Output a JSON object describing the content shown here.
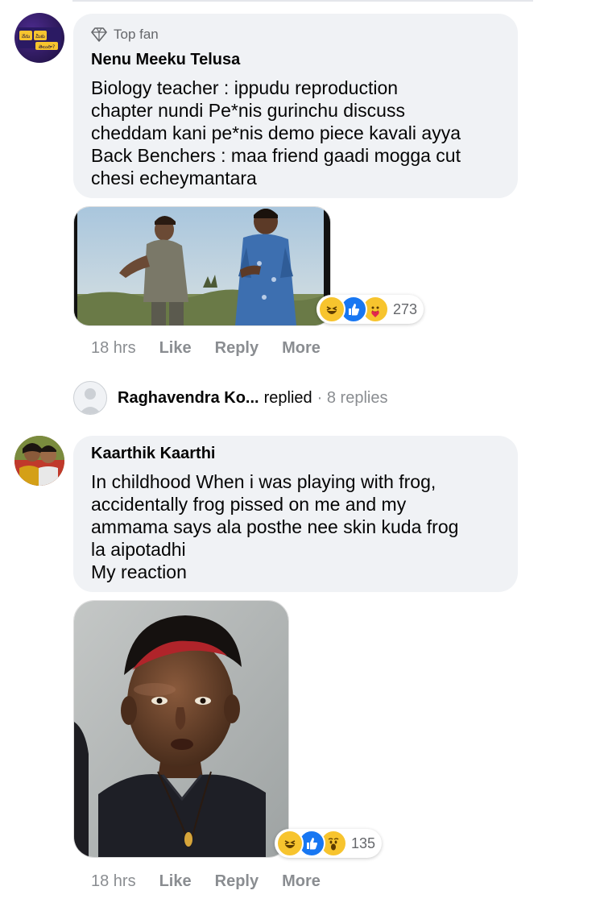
{
  "comment1": {
    "badge_label": "Top fan",
    "author": "Nenu Meeku Telusa",
    "avatar_text": [
      "నేను",
      "మీకు",
      "తెలుసా?"
    ],
    "text": "Biology teacher : ippudu reproduction\nchapter nundi Pe*nis gurinchu discuss\ncheddam kani pe*nis demo piece kavali ayya\nBack Benchers : maa friend gaadi mogga cut\nchesi echeymantara",
    "reaction_count": "273",
    "reaction_icons": [
      "haha-icon",
      "like-icon",
      "care-icon"
    ],
    "time": "18 hrs",
    "like_label": "Like",
    "reply_label": "Reply",
    "more_label": "More"
  },
  "replies_row": {
    "name": "Raghavendra Ko...",
    "action": "replied",
    "count": "· 8 replies"
  },
  "comment2": {
    "author": "Kaarthik Kaarthi",
    "text": "In childhood When i was playing with frog,\naccidentally frog pissed on me and my\nammama says ala posthe nee skin kuda frog\nla aipotadhi\nMy reaction",
    "reaction_count": "135",
    "reaction_icons": [
      "haha-icon",
      "like-icon",
      "wow-icon"
    ],
    "time": "18 hrs",
    "like_label": "Like",
    "reply_label": "Reply",
    "more_label": "More"
  },
  "colors": {
    "bubble": "#f0f2f5",
    "like_blue": "#1877f2",
    "emoji_yellow": "#f7c42e",
    "meta_gray": "#8a8d91"
  }
}
